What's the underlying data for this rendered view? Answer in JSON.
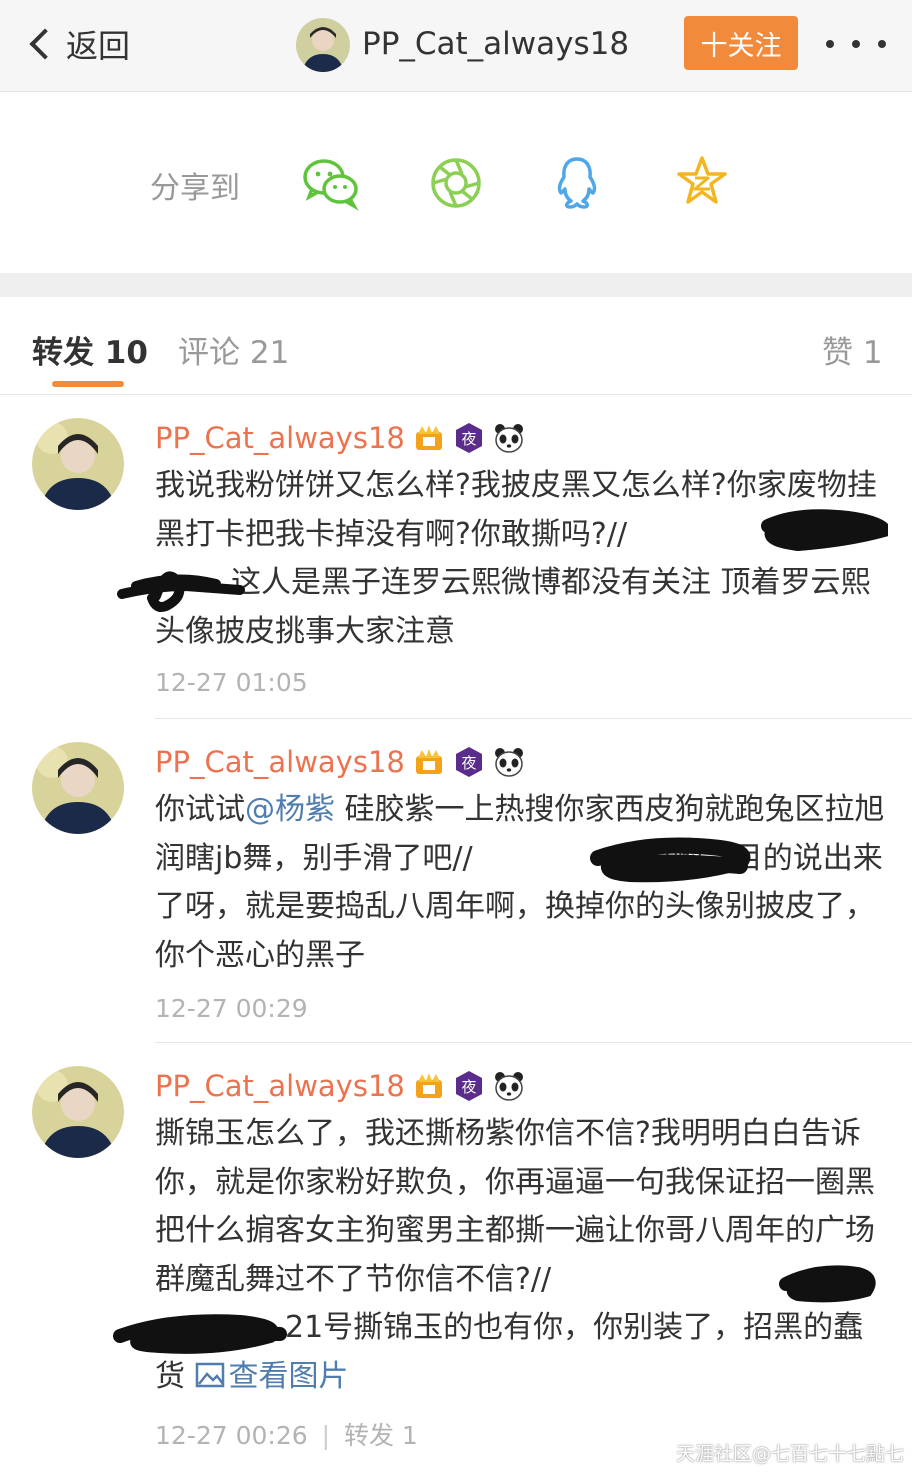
{
  "header": {
    "back_label": "返回",
    "title": "PP_Cat_always18",
    "follow_label": "十关注"
  },
  "share": {
    "label": "分享到",
    "icons": [
      "wechat-icon",
      "moments-icon",
      "qq-icon",
      "qzone-icon"
    ],
    "colors": {
      "wechat": "#5fc43c",
      "moments": "#8ccf55",
      "qq": "#4ea7e8",
      "qzone": "#f3b520"
    }
  },
  "tabs": {
    "repost": "转发 10",
    "comment": "评论 21",
    "like": "赞 1"
  },
  "accent_color": "#f28a3c",
  "username_color": "#eb7350",
  "link_color": "#507daf",
  "reposts": [
    {
      "user": "PP_Cat_always18",
      "text_a": "我说我粉饼饼又怎么样?我披皮黑又怎么样?你家废物挂黑打卡把我卡掉没有啊?你敢撕吗?//",
      "text_b": "这人是黑子连罗云熙微博都没有关注  顶着罗云熙头像披皮挑事大家注意",
      "time": "12-27 01:05"
    },
    {
      "user": "PP_Cat_always18",
      "text_a": "你试试",
      "mention": "@杨紫",
      "text_b": " 硅胶紫一上热搜你家西皮狗就跑兔区拉旭润瞎jb舞，别手滑了吧//",
      "text_c": ":哎哟，目的说出来了呀，就是要捣乱八周年啊，换掉你的头像别披皮了，你个恶心的黑子",
      "time": "12-27 00:29"
    },
    {
      "user": "PP_Cat_always18",
      "text_a": "撕锦玉怎么了，我还撕杨紫你信不信?我明明白白告诉你，就是你家粉好欺负，你再逼逼一句我保证招一圈黑把什么掮客女主狗蜜男主都撕一遍让你哥八周年的广场群魔乱舞过不了节你信不信?//",
      "text_b": "21号撕锦玉的也有你，你别装了，招黑的蠢货 ",
      "link": "查看图片",
      "time": "12-27 00:26",
      "repost_count": "转发 1"
    }
  ],
  "watermark": "天涯社区@七百七十七點七"
}
